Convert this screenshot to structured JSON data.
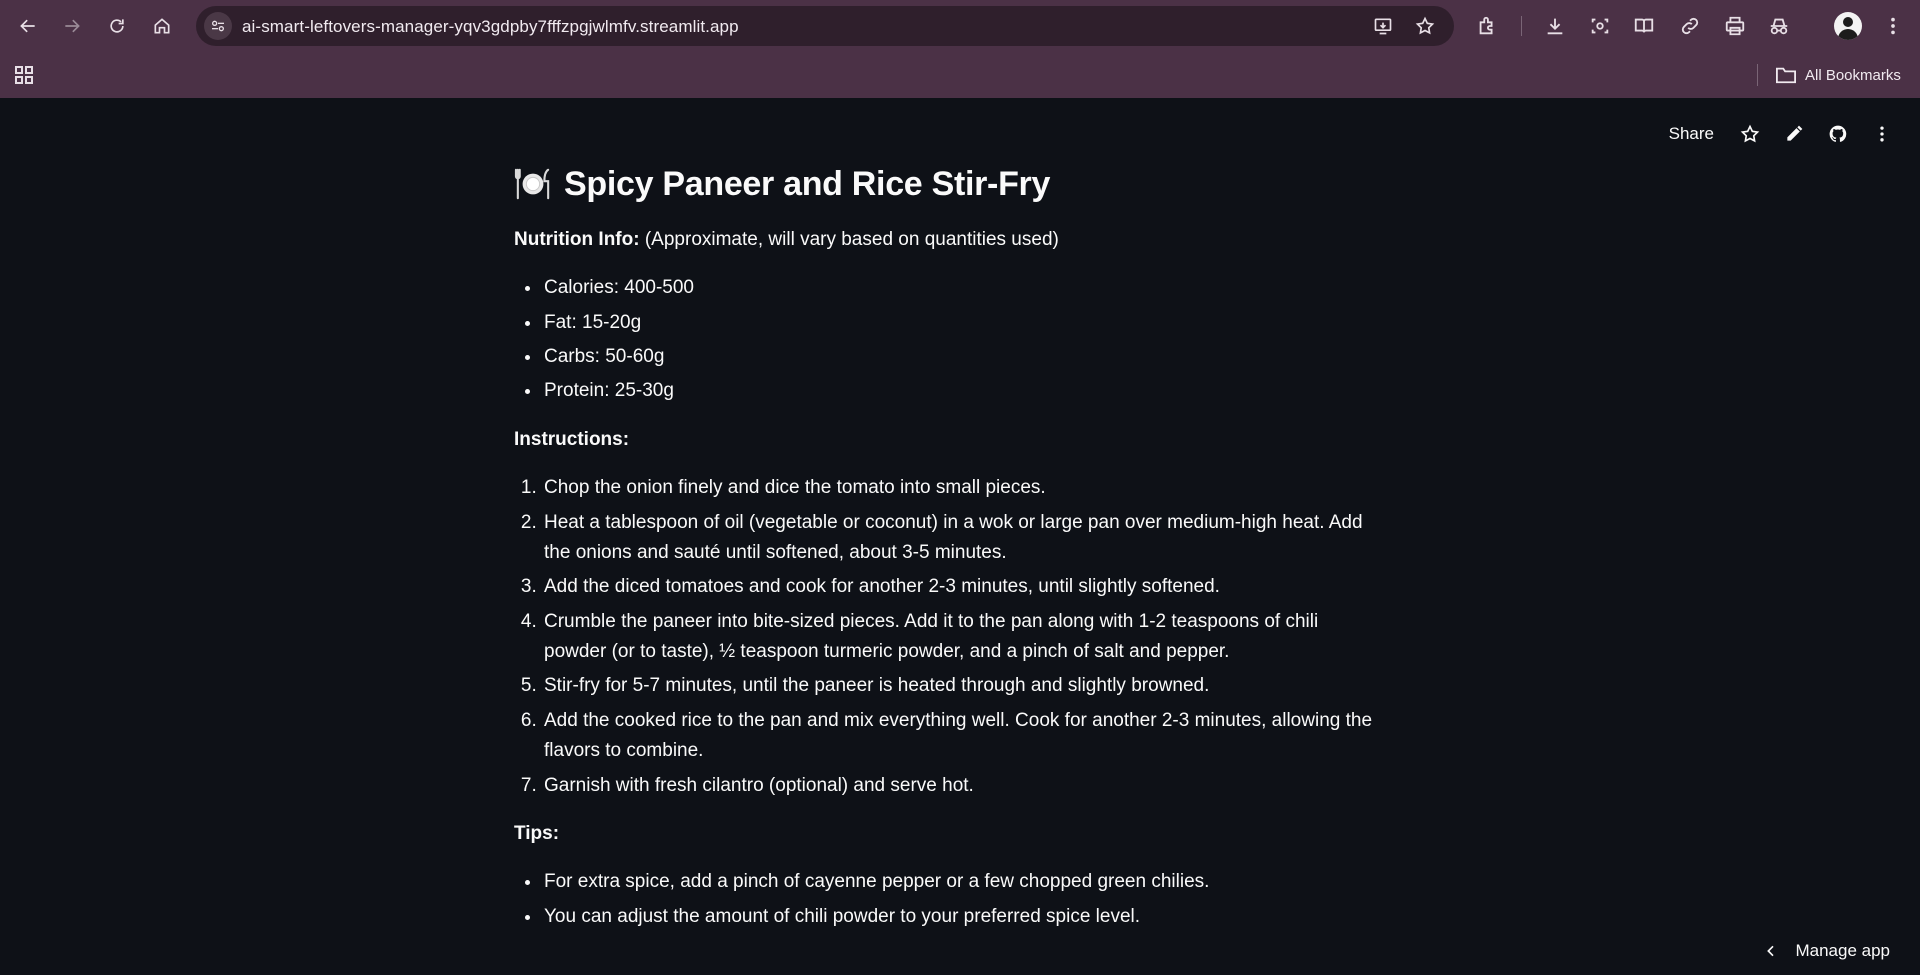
{
  "browser": {
    "url": "ai-smart-leftovers-manager-yqv3gdpby7fffzpgjwlmfv.streamlit.app",
    "bookmarks_label": "All Bookmarks"
  },
  "app_toolbar": {
    "share_label": "Share"
  },
  "recipe": {
    "title": "Spicy Paneer and Rice Stir-Fry",
    "nutrition_label": "Nutrition Info:",
    "nutrition_note": " (Approximate, will vary based on quantities used)",
    "nutrition_items": [
      "Calories: 400-500",
      "Fat: 15-20g",
      "Carbs: 50-60g",
      "Protein: 25-30g"
    ],
    "instructions_label": "Instructions:",
    "instructions": [
      "Chop the onion finely and dice the tomato into small pieces.",
      "Heat a tablespoon of oil (vegetable or coconut) in a wok or large pan over medium-high heat. Add the onions and sauté until softened, about 3-5 minutes.",
      "Add the diced tomatoes and cook for another 2-3 minutes, until slightly softened.",
      "Crumble the paneer into bite-sized pieces. Add it to the pan along with 1-2 teaspoons of chili powder (or to taste), ½ teaspoon turmeric powder, and a pinch of salt and pepper.",
      "Stir-fry for 5-7 minutes, until the paneer is heated through and slightly browned.",
      "Add the cooked rice to the pan and mix everything well. Cook for another 2-3 minutes, allowing the flavors to combine.",
      "Garnish with fresh cilantro (optional) and serve hot."
    ],
    "tips_label": "Tips:",
    "tips": [
      "For extra spice, add a pinch of cayenne pepper or a few chopped green chilies.",
      "You can adjust the amount of chili powder to your preferred spice level."
    ]
  },
  "manage_app_label": "Manage app",
  "colors": {
    "chrome": "#4b3146",
    "omnibox": "#2f1f2c",
    "app_bg": "#0e1117",
    "text": "#fafafa"
  }
}
